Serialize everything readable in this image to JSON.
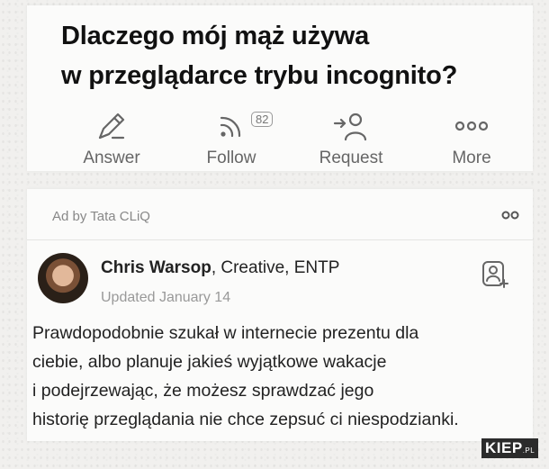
{
  "question": {
    "line1": "Dlaczego mój mąż używa",
    "line2": "w przeglądarce trybu incognito?"
  },
  "actions": {
    "answer": "Answer",
    "follow": "Follow",
    "follow_count": "82",
    "request": "Request",
    "more": "More"
  },
  "ad_label": "Ad by Tata CLiQ",
  "answer": {
    "author_name": "Chris Warsop",
    "author_credential": ", Creative, ENTP",
    "updated": "Updated January 14",
    "text_lines": [
      "Prawdopodobnie szukał w internecie prezentu dla",
      "ciebie, albo planuje jakieś wyjątkowe wakacje",
      "i podejrzewając, że możesz sprawdzać jego",
      "historię przeglądania nie chce zepsuć ci niespodzianki."
    ]
  },
  "watermark": {
    "main": "KIEP",
    "suffix": ".PL"
  },
  "colors": {
    "icon": "#666666",
    "muted": "#999999",
    "text": "#222222"
  },
  "icons": [
    "edit-icon",
    "rss-follow-icon",
    "request-user-icon",
    "more-dots-icon",
    "add-profile-icon"
  ]
}
